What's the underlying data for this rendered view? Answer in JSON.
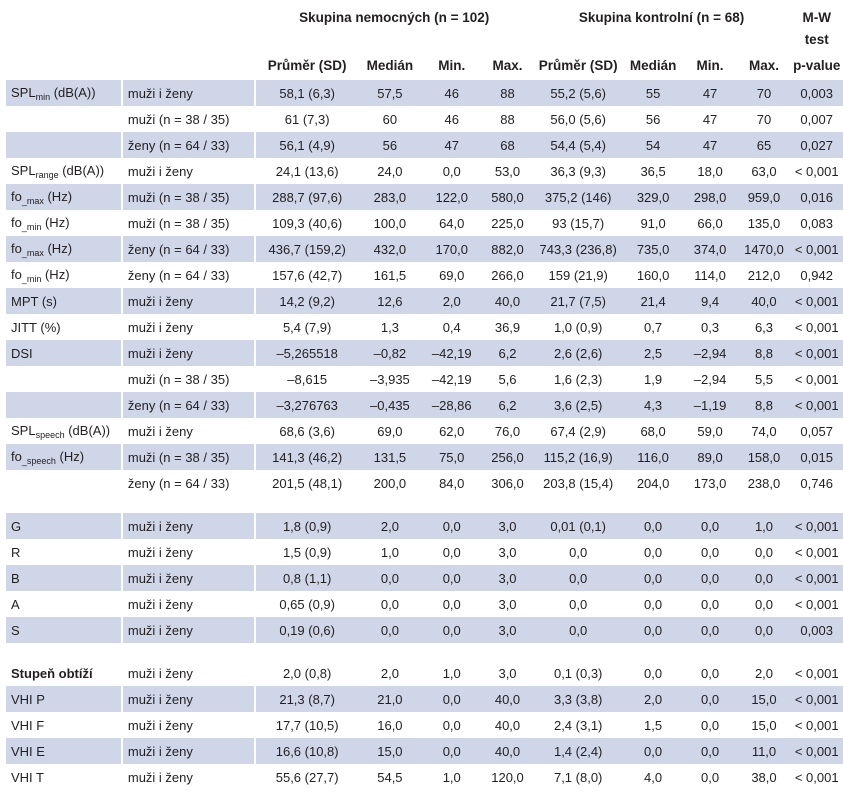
{
  "header": {
    "group_patients": "Skupina nemocných (n = 102)",
    "group_controls": "Skupina kontrolní (n = 68)",
    "test_line1": "M-W",
    "test_line2": "test",
    "columns": [
      "Průměr (SD)",
      "Medián",
      "Min.",
      "Max.",
      "Průměr (SD)",
      "Medián",
      "Min.",
      "Max.",
      "p-value"
    ]
  },
  "rows": [
    {
      "shaded": true,
      "param": "SPL",
      "sub": "min",
      "unit": " (dB(A))",
      "group": "muži i ženy",
      "values": [
        "58,1 (6,3)",
        "57,5",
        "46",
        "88",
        "55,2 (5,6)",
        "55",
        "47",
        "70",
        "0,003"
      ]
    },
    {
      "shaded": false,
      "param": "",
      "sub": "",
      "unit": "",
      "group": "muži (n = 38 / 35)",
      "values": [
        "61 (7,3)",
        "60",
        "46",
        "88",
        "56,0 (5,6)",
        "56",
        "47",
        "70",
        "0,007"
      ]
    },
    {
      "shaded": true,
      "param": "",
      "sub": "",
      "unit": "",
      "group": "ženy (n = 64 / 33)",
      "values": [
        "56,1 (4,9)",
        "56",
        "47",
        "68",
        "54,4 (5,4)",
        "54",
        "47",
        "65",
        "0,027"
      ]
    },
    {
      "shaded": false,
      "param": "SPL",
      "sub": "range",
      "unit": " (dB(A))",
      "group": "muži i ženy",
      "values": [
        "24,1 (13,6)",
        "24,0",
        "0,0",
        "53,0",
        "36,3 (9,3)",
        "36,5",
        "18,0",
        "63,0",
        "< 0,001"
      ]
    },
    {
      "shaded": true,
      "param": "fo",
      "sub": "_max",
      "unit": " (Hz)",
      "group": "muži (n = 38 / 35)",
      "values": [
        "288,7 (97,6)",
        "283,0",
        "122,0",
        "580,0",
        "375,2 (146)",
        "329,0",
        "298,0",
        "959,0",
        "0,016"
      ]
    },
    {
      "shaded": false,
      "param": "fo",
      "sub": "_min",
      "unit": " (Hz)",
      "group": "muži (n = 38 / 35)",
      "values": [
        "109,3 (40,6)",
        "100,0",
        "64,0",
        "225,0",
        "93 (15,7)",
        "91,0",
        "66,0",
        "135,0",
        "0,083"
      ]
    },
    {
      "shaded": true,
      "param": "fo",
      "sub": "_max",
      "unit": " (Hz)",
      "group": "ženy (n = 64 / 33)",
      "values": [
        "436,7 (159,2)",
        "432,0",
        "170,0",
        "882,0",
        "743,3 (236,8)",
        "735,0",
        "374,0",
        "1470,0",
        "< 0,001"
      ]
    },
    {
      "shaded": false,
      "param": "fo",
      "sub": "_min",
      "unit": " (Hz)",
      "group": "ženy (n = 64 / 33)",
      "values": [
        "157,6 (42,7)",
        "161,5",
        "69,0",
        "266,0",
        "159 (21,9)",
        "160,0",
        "114,0",
        "212,0",
        "0,942"
      ]
    },
    {
      "shaded": true,
      "param": "MPT (s)",
      "sub": "",
      "unit": "",
      "group": "muži i ženy",
      "values": [
        "14,2 (9,2)",
        "12,6",
        "2,0",
        "40,0",
        "21,7 (7,5)",
        "21,4",
        "9,4",
        "40,0",
        "< 0,001"
      ]
    },
    {
      "shaded": false,
      "param": "JITT (%)",
      "sub": "",
      "unit": "",
      "group": "muži i ženy",
      "values": [
        "5,4 (7,9)",
        "1,3",
        "0,4",
        "36,9",
        "1,0 (0,9)",
        "0,7",
        "0,3",
        "6,3",
        "< 0,001"
      ]
    },
    {
      "shaded": true,
      "param": "DSI",
      "sub": "",
      "unit": "",
      "group": "muži i ženy",
      "values": [
        "–5,265518",
        "–0,82",
        "–42,19",
        "6,2",
        "2,6 (2,6)",
        "2,5",
        "–2,94",
        "8,8",
        "< 0,001"
      ]
    },
    {
      "shaded": false,
      "param": "",
      "sub": "",
      "unit": "",
      "group": "muži (n = 38 / 35)",
      "values": [
        "–8,615",
        "–3,935",
        "–42,19",
        "5,6",
        "1,6 (2,3)",
        "1,9",
        "–2,94",
        "5,5",
        "< 0,001"
      ]
    },
    {
      "shaded": true,
      "param": "",
      "sub": "",
      "unit": "",
      "group": "ženy (n = 64 / 33)",
      "values": [
        "–3,276763",
        "–0,435",
        "–28,86",
        "6,2",
        "3,6 (2,5)",
        "4,3",
        "–1,19",
        "8,8",
        "< 0,001"
      ]
    },
    {
      "shaded": false,
      "param": "SPL",
      "sub": "speech",
      "unit": " (dB(A))",
      "group": "muži i ženy",
      "values": [
        "68,6 (3,6)",
        "69,0",
        "62,0",
        "76,0",
        "67,4 (2,9)",
        "68,0",
        "59,0",
        "74,0",
        "0,057"
      ]
    },
    {
      "shaded": true,
      "param": "fo",
      "sub": "_speech",
      "unit": " (Hz)",
      "group": "muži (n = 38 / 35)",
      "values": [
        "141,3 (46,2)",
        "131,5",
        "75,0",
        "256,0",
        "115,2 (16,9)",
        "116,0",
        "89,0",
        "158,0",
        "0,015"
      ]
    },
    {
      "shaded": false,
      "param": "",
      "sub": "",
      "unit": "",
      "group": "ženy (n = 64 / 33)",
      "values": [
        "201,5 (48,1)",
        "200,0",
        "84,0",
        "306,0",
        "203,8 (15,4)",
        "204,0",
        "173,0",
        "238,0",
        "0,746"
      ]
    },
    {
      "blank": true
    },
    {
      "shaded": true,
      "param": "G",
      "sub": "",
      "unit": "",
      "group": "muži i ženy",
      "values": [
        "1,8 (0,9)",
        "2,0",
        "0,0",
        "3,0",
        "0,01 (0,1)",
        "0,0",
        "0,0",
        "1,0",
        "< 0,001"
      ]
    },
    {
      "shaded": false,
      "param": "R",
      "sub": "",
      "unit": "",
      "group": "muži i ženy",
      "values": [
        "1,5 (0,9)",
        "1,0",
        "0,0",
        "3,0",
        "0,0",
        "0,0",
        "0,0",
        "0,0",
        "< 0,001"
      ]
    },
    {
      "shaded": true,
      "param": "B",
      "sub": "",
      "unit": "",
      "group": "muži i ženy",
      "values": [
        "0,8 (1,1)",
        "0,0",
        "0,0",
        "3,0",
        "0,0",
        "0,0",
        "0,0",
        "0,0",
        "< 0,001"
      ]
    },
    {
      "shaded": false,
      "param": "A",
      "sub": "",
      "unit": "",
      "group": "muži i ženy",
      "values": [
        "0,65 (0,9)",
        "0,0",
        "0,0",
        "3,0",
        "0,0",
        "0,0",
        "0,0",
        "0,0",
        "< 0,001"
      ]
    },
    {
      "shaded": true,
      "param": "S",
      "sub": "",
      "unit": "",
      "group": "muži i ženy",
      "values": [
        "0,19 (0,6)",
        "0,0",
        "0,0",
        "3,0",
        "0,0",
        "0,0",
        "0,0",
        "0,0",
        "0,003"
      ]
    },
    {
      "blank": true
    },
    {
      "shaded": false,
      "param": "Stupeň obtíží",
      "bold": true,
      "sub": "",
      "unit": "",
      "group": "muži i ženy",
      "values": [
        "2,0 (0,8)",
        "2,0",
        "1,0",
        "3,0",
        "0,1 (0,3)",
        "0,0",
        "0,0",
        "2,0",
        "< 0,001"
      ]
    },
    {
      "shaded": true,
      "param": "VHI P",
      "sub": "",
      "unit": "",
      "group": "muži i ženy",
      "values": [
        "21,3 (8,7)",
        "21,0",
        "0,0",
        "40,0",
        "3,3 (3,8)",
        "2,0",
        "0,0",
        "15,0",
        "< 0,001"
      ]
    },
    {
      "shaded": false,
      "param": "VHI F",
      "sub": "",
      "unit": "",
      "group": "muži i ženy",
      "values": [
        "17,7 (10,5)",
        "16,0",
        "0,0",
        "40,0",
        "2,4 (3,1)",
        "1,5",
        "0,0",
        "15,0",
        "< 0,001"
      ]
    },
    {
      "shaded": true,
      "param": "VHI E",
      "sub": "",
      "unit": "",
      "group": "muži i ženy",
      "values": [
        "16,6 (10,8)",
        "15,0",
        "0,0",
        "40,0",
        "1,4 (2,4)",
        "0,0",
        "0,0",
        "11,0",
        "< 0,001"
      ]
    },
    {
      "shaded": false,
      "param": "VHI T",
      "sub": "",
      "unit": "",
      "group": "muži i ženy",
      "values": [
        "55,6 (27,7)",
        "54,5",
        "1,0",
        "120,0",
        "7,1 (8,0)",
        "4,0",
        "0,0",
        "38,0",
        "< 0,001"
      ]
    }
  ]
}
